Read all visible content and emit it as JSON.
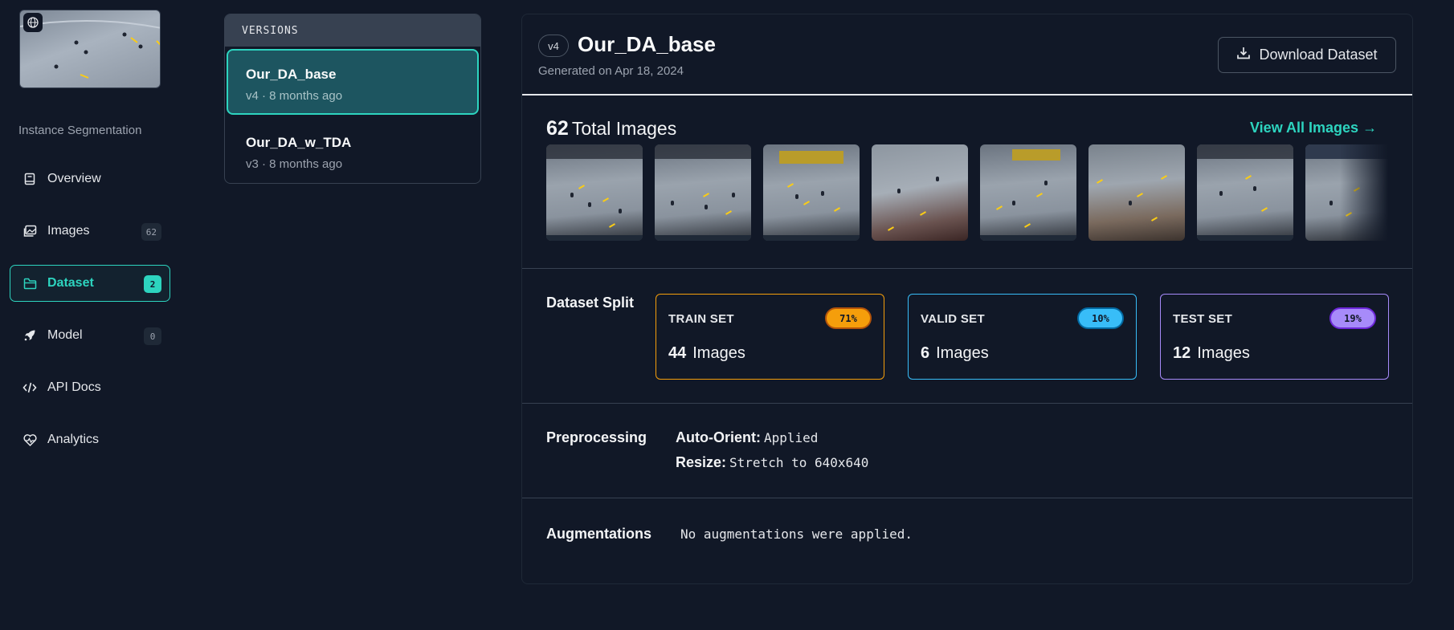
{
  "sidebar": {
    "project_type": "Instance Segmentation",
    "items": [
      {
        "label": "Overview",
        "icon": "book-icon",
        "count": ""
      },
      {
        "label": "Images",
        "icon": "image-icon",
        "count": "62"
      },
      {
        "label": "Dataset",
        "icon": "folder-icon",
        "count": "2",
        "active": true
      },
      {
        "label": "Model",
        "icon": "rocket-icon",
        "count": "0"
      },
      {
        "label": "API Docs",
        "icon": "code-icon",
        "count": ""
      },
      {
        "label": "Analytics",
        "icon": "heart-pulse-icon",
        "count": ""
      }
    ]
  },
  "versions": {
    "header": "VERSIONS",
    "items": [
      {
        "name": "Our_DA_base",
        "meta": "v4 · 8 months ago",
        "selected": true
      },
      {
        "name": "Our_DA_w_TDA",
        "meta": "v3 · 8 months ago",
        "selected": false
      }
    ]
  },
  "dataset": {
    "version_badge": "v4",
    "title": "Our_DA_base",
    "generated": "Generated on Apr 18, 2024",
    "download_label": "Download Dataset",
    "total_count": "62",
    "total_label": "Total Images",
    "view_all_label": "View All Images →",
    "split_label": "Dataset Split",
    "splits": [
      {
        "name": "TRAIN SET",
        "pct": "71%",
        "count": "44",
        "unit": "Images",
        "color": "#f59e0b"
      },
      {
        "name": "VALID SET",
        "pct": "10%",
        "count": "6",
        "unit": "Images",
        "color": "#38bdf8"
      },
      {
        "name": "TEST SET",
        "pct": "19%",
        "count": "12",
        "unit": "Images",
        "color": "#a78bfa"
      }
    ],
    "preprocessing_label": "Preprocessing",
    "preprocessing": [
      {
        "key": "Auto-Orient:",
        "value": "Applied"
      },
      {
        "key": "Resize:",
        "value": "Stretch to 640x640"
      }
    ],
    "augmentations_label": "Augmentations",
    "augmentations_text": "No augmentations were applied."
  },
  "colors": {
    "accent": "#2dd4bf",
    "background": "#111827"
  }
}
